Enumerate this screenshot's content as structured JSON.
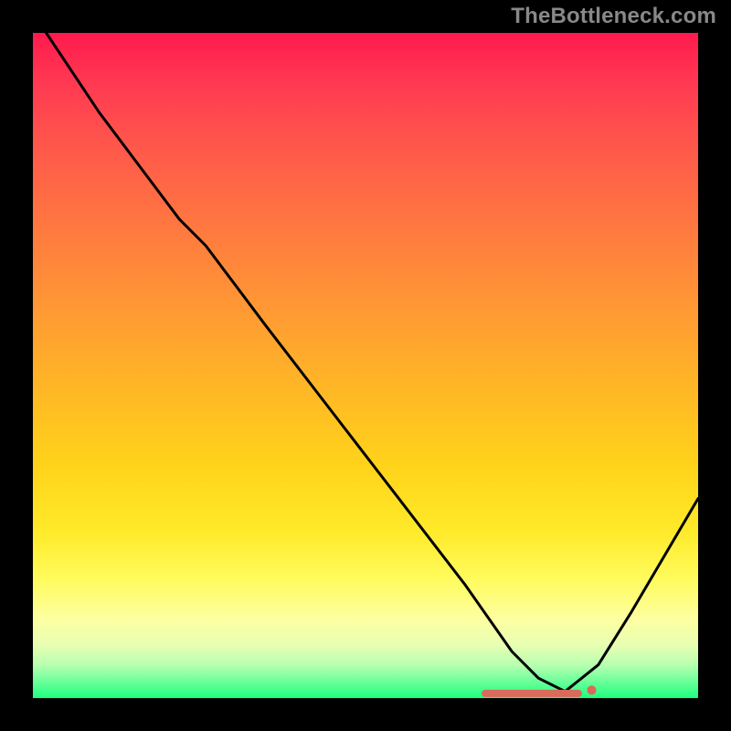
{
  "watermark": "TheBottleneck.com",
  "colors": {
    "background": "#000000",
    "curve": "#000000",
    "marker": "#d96a5c"
  },
  "chart_data": {
    "type": "line",
    "title": "",
    "xlabel": "",
    "ylabel": "",
    "xlim": [
      0,
      100
    ],
    "ylim": [
      0,
      100
    ],
    "grid": false,
    "series": [
      {
        "name": "bottleneck-curve",
        "x": [
          2,
          10,
          16,
          22,
          26,
          35,
          45,
          55,
          65,
          72,
          76,
          80,
          85,
          90,
          100
        ],
        "values": [
          100,
          88,
          80,
          72,
          68,
          56,
          43,
          30,
          17,
          7,
          3,
          1,
          5,
          13,
          30
        ]
      }
    ],
    "annotations": [
      {
        "name": "optimal-marker-line",
        "x_start": 68,
        "x_end": 82,
        "y": 0.7
      },
      {
        "name": "optimal-marker-dot",
        "x": 84,
        "y": 1.2
      }
    ]
  }
}
